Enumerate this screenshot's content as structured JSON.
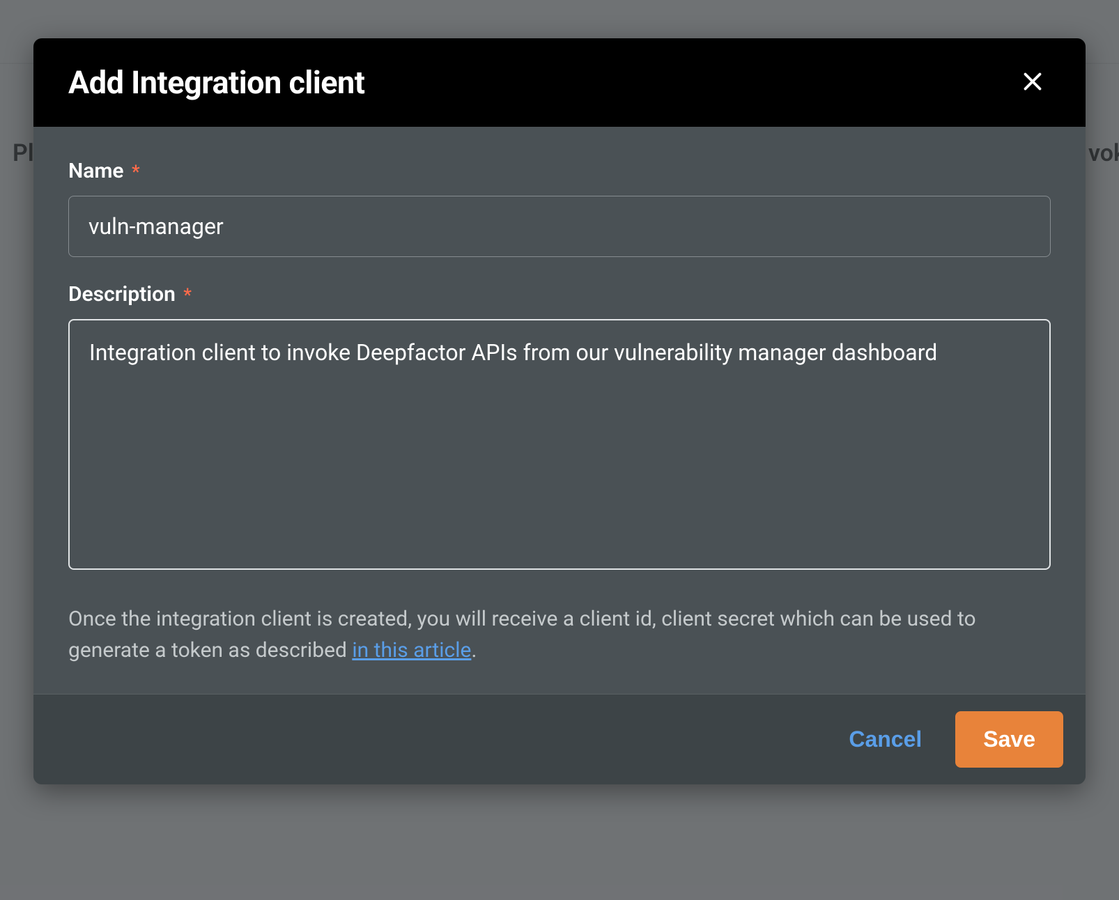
{
  "backdrop": {
    "left_text": "Ple",
    "right_text": "vok"
  },
  "modal": {
    "title": "Add Integration client",
    "fields": {
      "name": {
        "label": "Name",
        "value": "vuln-manager",
        "required": "*"
      },
      "description": {
        "label": "Description",
        "value": "Integration client to invoke Deepfactor APIs from our vulnerability manager dashboard",
        "required": "*"
      }
    },
    "helper_text_prefix": "Once the integration client is created, you will receive a client id, client secret which can be used to generate a token as described ",
    "helper_link_text": "in this article",
    "helper_text_suffix": ".",
    "buttons": {
      "cancel": "Cancel",
      "save": "Save"
    }
  }
}
